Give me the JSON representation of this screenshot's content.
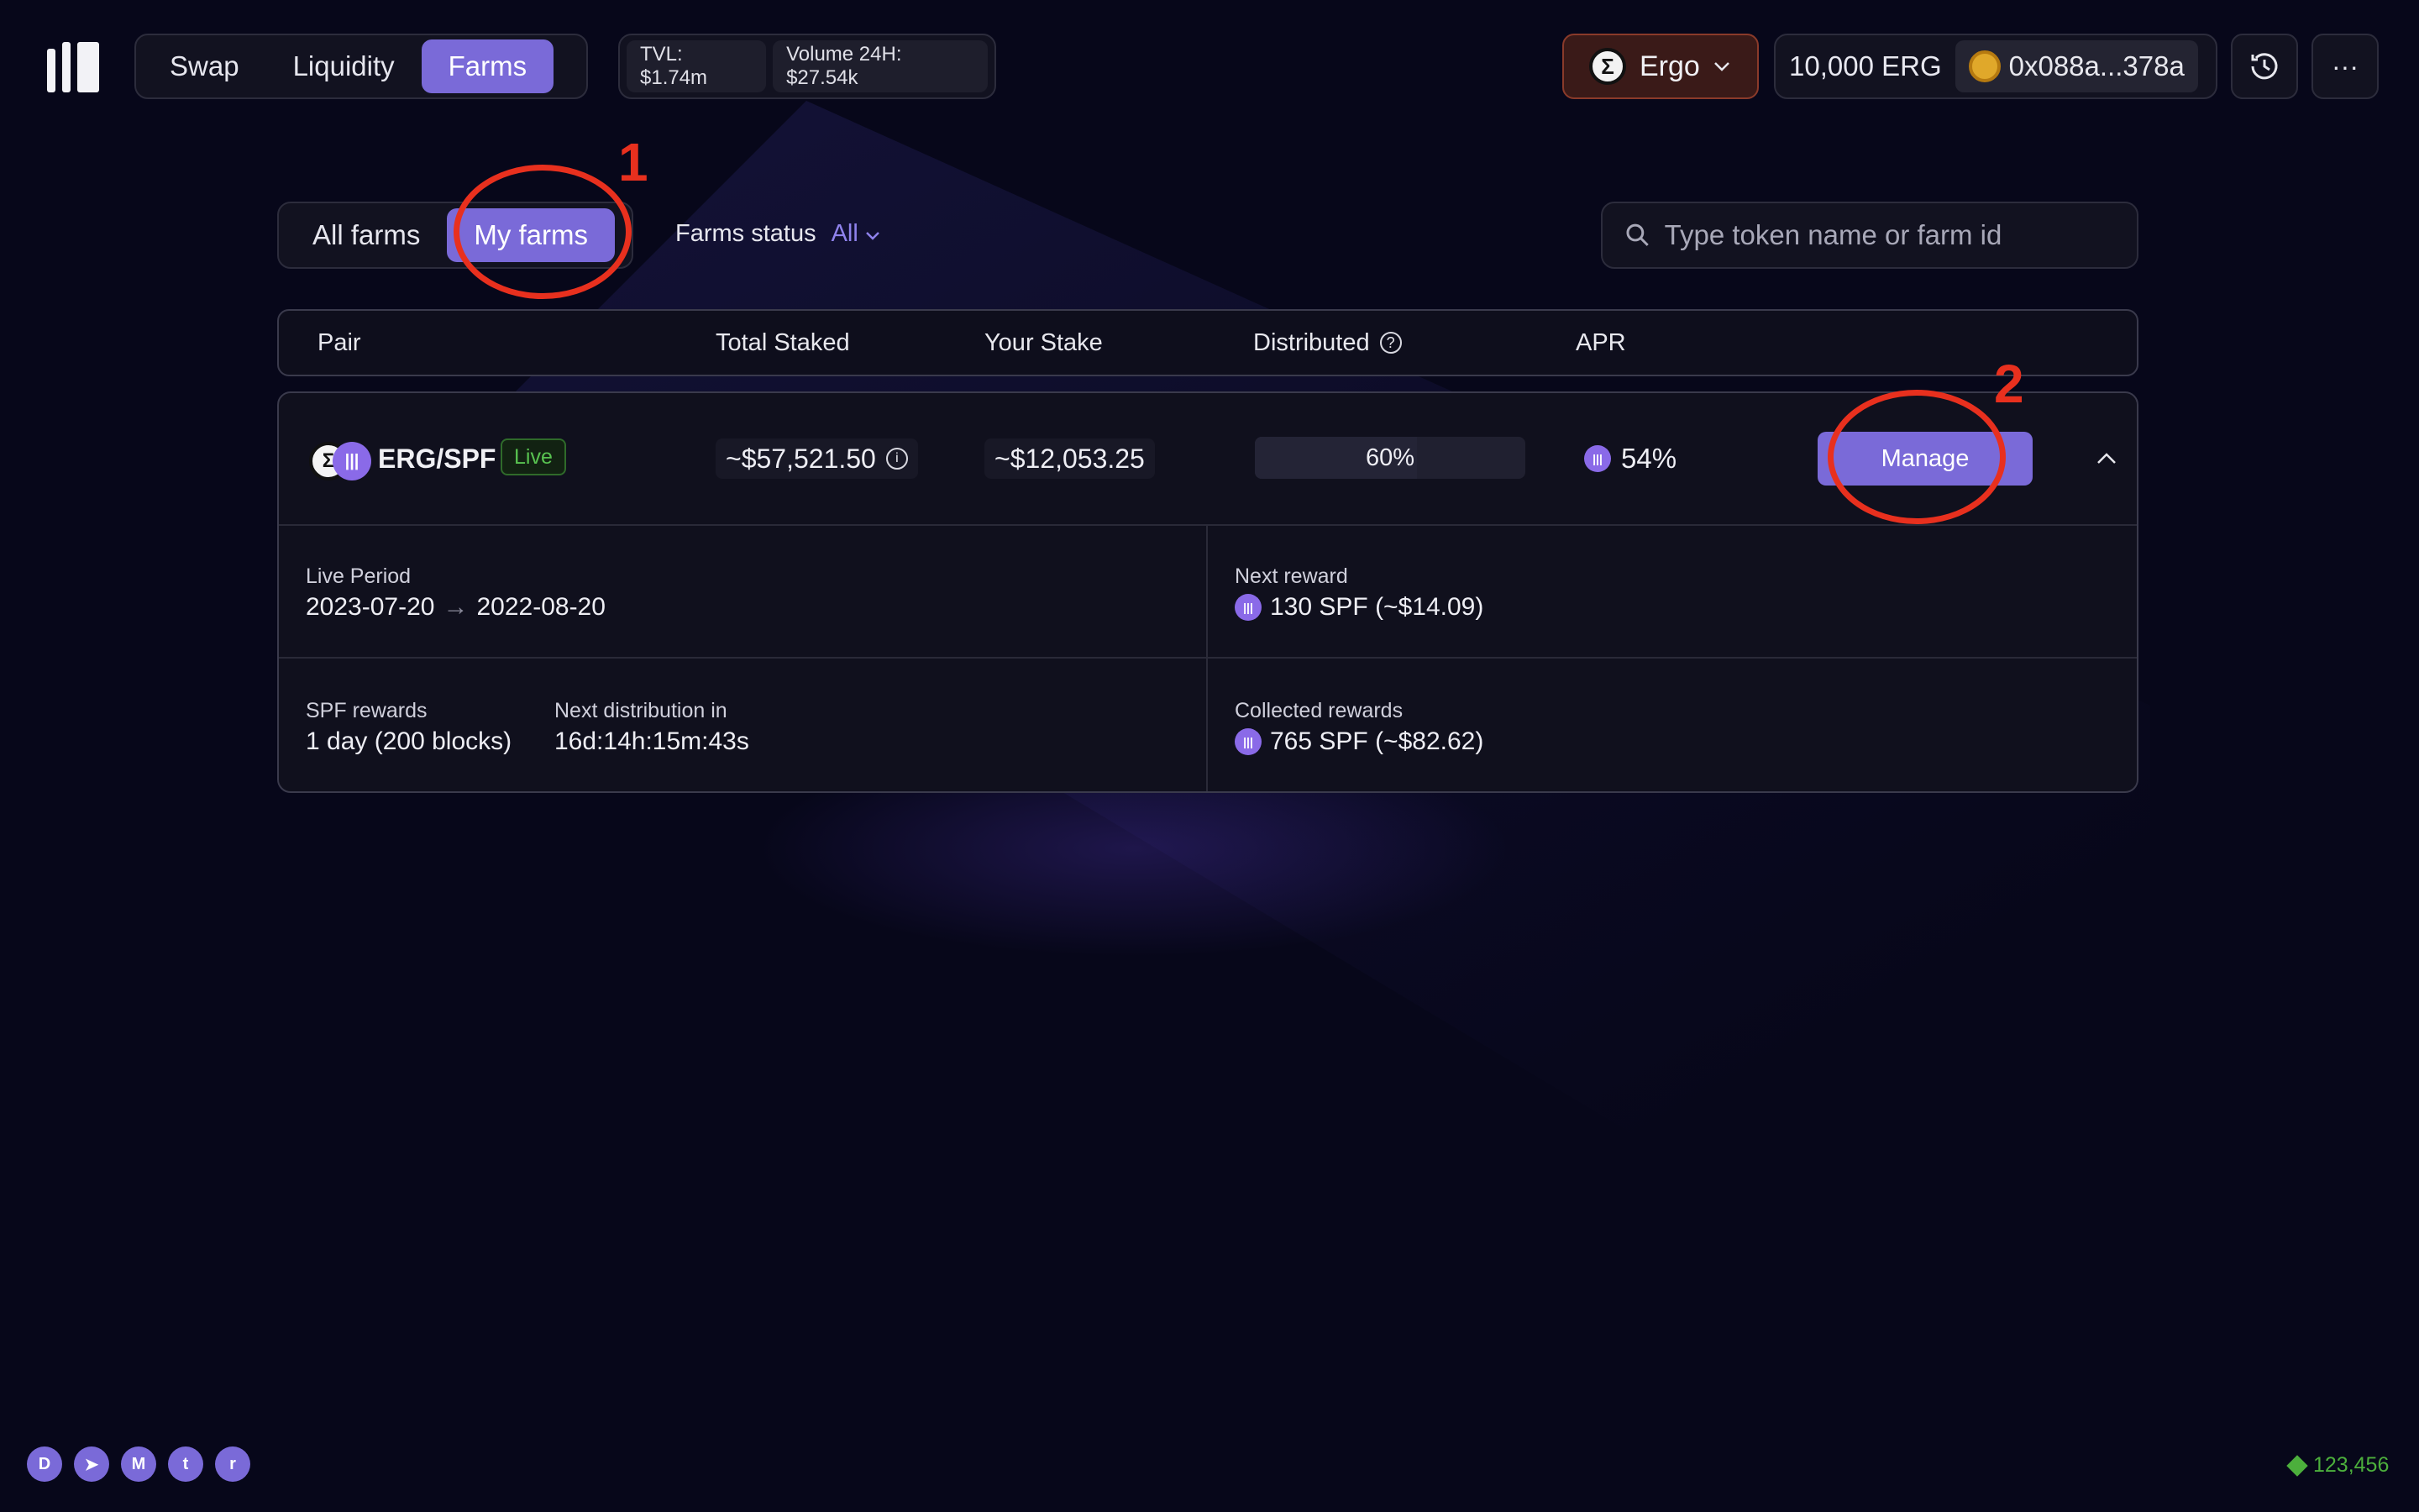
{
  "header": {
    "nav": [
      {
        "label": "Swap"
      },
      {
        "label": "Liquidity"
      },
      {
        "label": "Farms"
      }
    ],
    "tvl": "TVL: $1.74m",
    "volume": "Volume 24H: $27.54k",
    "network": "Ergo",
    "balance": "10,000 ERG",
    "address": "0x088a...378a",
    "history_icon": "clock-icon",
    "more_label": "···"
  },
  "filters": {
    "tabs": [
      {
        "label": "All farms"
      },
      {
        "label": "My farms"
      }
    ],
    "status_label": "Farms status",
    "status_value": "All",
    "search_placeholder": "Type token name or farm id"
  },
  "table": {
    "headers": {
      "pair": "Pair",
      "total_staked": "Total Staked",
      "your_stake": "Your Stake",
      "distributed": "Distributed",
      "apr": "APR"
    },
    "rows": [
      {
        "pair": "ERG/SPF",
        "status": "Live",
        "total_staked": "~$57,521.50",
        "your_stake": "~$12,053.25",
        "distributed": "60%",
        "distributed_fraction": 0.6,
        "apr": "54%",
        "manage_label": "Manage",
        "details": {
          "live_period_label": "Live Period",
          "live_period_start": "2023-07-20",
          "live_period_arrow": "→",
          "live_period_end": "2022-08-20",
          "next_reward_label": "Next reward",
          "next_reward_value": "130 SPF (~$14.09)",
          "spf_rewards_label": "SPF rewards",
          "spf_rewards_value": "1 day (200 blocks)",
          "next_distribution_label": "Next distribution in",
          "next_distribution_value": "16d:14h:15m:43s",
          "collected_label": "Collected rewards",
          "collected_value": "765 SPF (~$82.62)"
        }
      }
    ]
  },
  "annotations": {
    "one": "1",
    "two": "2"
  },
  "footer": {
    "socials": [
      "discord-icon",
      "telegram-icon",
      "medium-icon",
      "twitter-icon",
      "reddit-icon"
    ],
    "block_height": "123,456"
  },
  "colors": {
    "accent": "#7a6ad8",
    "background": "#07071a",
    "annotation": "#e8301e",
    "live": "#58c250"
  }
}
